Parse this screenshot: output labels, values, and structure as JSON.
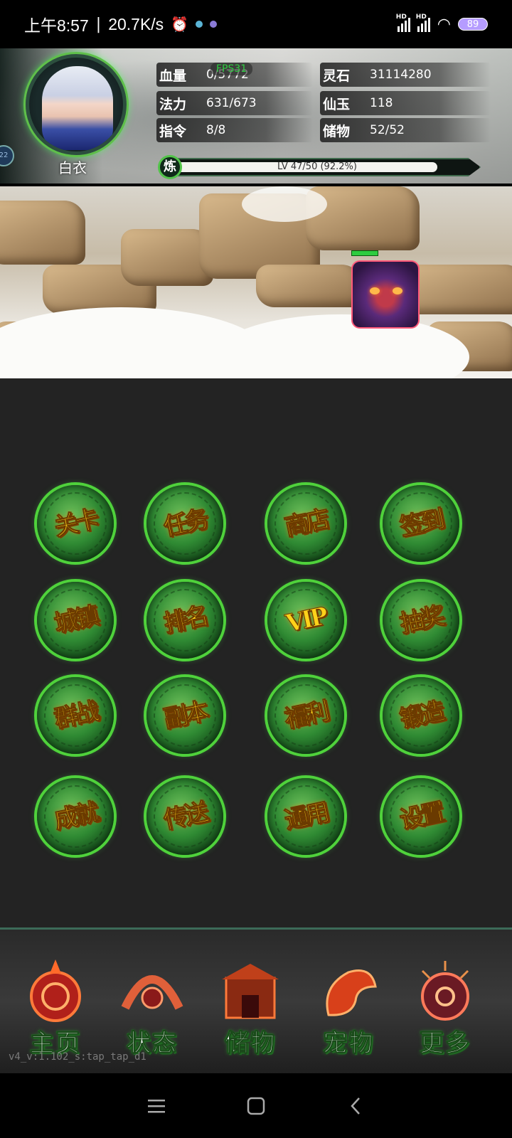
{
  "status_bar": {
    "time": "上午8:57",
    "speed": "20.7K/s",
    "battery": "89",
    "signal_label": "HD"
  },
  "player": {
    "name": "白衣",
    "badge": "22",
    "stats": {
      "hp_label": "血量",
      "hp_value": "0/5772",
      "mp_label": "法力",
      "mp_value": "631/673",
      "cmd_label": "指令",
      "cmd_value": "8/8",
      "stone_label": "灵石",
      "stone_value": "31114280",
      "jade_label": "仙玉",
      "jade_value": "118",
      "storage_label": "储物",
      "storage_value": "52/52"
    },
    "fps": "FPS31",
    "exp": {
      "badge": "炼",
      "text": "LV 47/50 (92.2%)",
      "progress": 0.922
    }
  },
  "enemy": {
    "hp_fraction": 0.4
  },
  "menu": [
    {
      "label": "关卡",
      "name": "menu-stage-button"
    },
    {
      "label": "任务",
      "name": "menu-quest-button"
    },
    {
      "label": "商店",
      "name": "menu-shop-button"
    },
    {
      "label": "签到",
      "name": "menu-checkin-button"
    },
    {
      "label": "城镇",
      "name": "menu-town-button"
    },
    {
      "label": "排名",
      "name": "menu-ranking-button"
    },
    {
      "label": "VIP",
      "name": "menu-vip-button"
    },
    {
      "label": "抽奖",
      "name": "menu-lottery-button"
    },
    {
      "label": "群战",
      "name": "menu-group-battle-button"
    },
    {
      "label": "副本",
      "name": "menu-dungeon-button"
    },
    {
      "label": "福利",
      "name": "menu-welfare-button"
    },
    {
      "label": "锻造",
      "name": "menu-forge-button"
    },
    {
      "label": "成就",
      "name": "menu-achievement-button"
    },
    {
      "label": "传送",
      "name": "menu-teleport-button"
    },
    {
      "label": "通用",
      "name": "menu-general-button"
    },
    {
      "label": "设置",
      "name": "menu-settings-button"
    }
  ],
  "bottom_nav": [
    {
      "label": "主页",
      "name": "nav-home"
    },
    {
      "label": "状态",
      "name": "nav-status"
    },
    {
      "label": "储物",
      "name": "nav-storage"
    },
    {
      "label": "宠物",
      "name": "nav-pet"
    },
    {
      "label": "更多",
      "name": "nav-more"
    }
  ],
  "version": "v4_v:1.102_s:tap_tap_d1",
  "system_nav": {
    "menu_icon": "☰",
    "home_icon": "▢",
    "back_icon": "‹"
  }
}
